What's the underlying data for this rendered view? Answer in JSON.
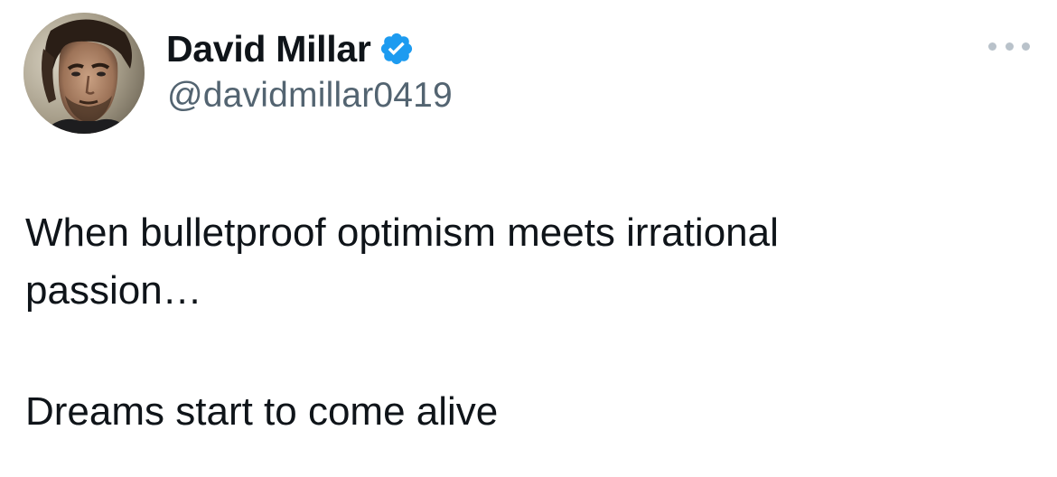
{
  "author": {
    "display_name": "David Millar",
    "handle": "@davidmillar0419",
    "verified": true,
    "avatar_icon": "profile-photo"
  },
  "tweet": {
    "text_line_1": "When bulletproof optimism meets irrational",
    "text_line_2": "passion…",
    "text_line_3": "Dreams start to come alive"
  },
  "menu": {
    "icon": "more-options-icon"
  },
  "colors": {
    "text_primary": "#0f1419",
    "text_secondary": "#536471",
    "verified_badge": "#1d9bf0",
    "more_dots": "#b9c2ca",
    "background": "#ffffff"
  }
}
